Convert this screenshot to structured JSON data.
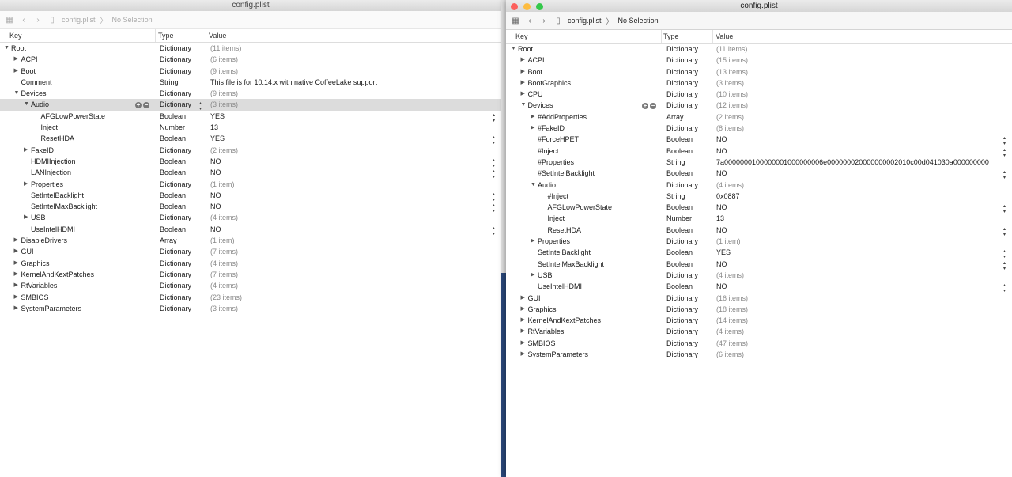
{
  "left": {
    "title": "config.plist",
    "breadcrumb_file": "config.plist",
    "breadcrumb_sep": "〉",
    "breadcrumb_selection": "No Selection",
    "headers": {
      "key": "Key",
      "type": "Type",
      "value": "Value"
    },
    "rows": [
      {
        "k": "Root",
        "t": "Dictionary",
        "v": "(11 items)",
        "lvl": 0,
        "tri": "open",
        "muted": true
      },
      {
        "k": "ACPI",
        "t": "Dictionary",
        "v": "(6 items)",
        "lvl": 1,
        "tri": "closed",
        "muted": true
      },
      {
        "k": "Boot",
        "t": "Dictionary",
        "v": "(9 items)",
        "lvl": 1,
        "tri": "closed",
        "muted": true
      },
      {
        "k": "Comment",
        "t": "String",
        "v": "This file is for 10.14.x with native CoffeeLake support",
        "lvl": 1
      },
      {
        "k": "Devices",
        "t": "Dictionary",
        "v": "(9 items)",
        "lvl": 1,
        "tri": "open",
        "muted": true
      },
      {
        "k": "Audio",
        "t": "Dictionary",
        "v": "(3 items)",
        "lvl": 2,
        "tri": "open",
        "muted": true,
        "sel": true,
        "pm": true,
        "step": true
      },
      {
        "k": "AFGLowPowerState",
        "t": "Boolean",
        "v": "YES",
        "lvl": 3,
        "step": true
      },
      {
        "k": "Inject",
        "t": "Number",
        "v": "13",
        "lvl": 3
      },
      {
        "k": "ResetHDA",
        "t": "Boolean",
        "v": "YES",
        "lvl": 3,
        "step": true
      },
      {
        "k": "FakeID",
        "t": "Dictionary",
        "v": "(2 items)",
        "lvl": 2,
        "tri": "closed",
        "muted": true
      },
      {
        "k": "HDMIInjection",
        "t": "Boolean",
        "v": "NO",
        "lvl": 2,
        "step": true
      },
      {
        "k": "LANInjection",
        "t": "Boolean",
        "v": "NO",
        "lvl": 2,
        "step": true
      },
      {
        "k": "Properties",
        "t": "Dictionary",
        "v": "(1 item)",
        "lvl": 2,
        "tri": "closed",
        "muted": true
      },
      {
        "k": "SetIntelBacklight",
        "t": "Boolean",
        "v": "NO",
        "lvl": 2,
        "step": true
      },
      {
        "k": "SetIntelMaxBacklight",
        "t": "Boolean",
        "v": "NO",
        "lvl": 2,
        "step": true
      },
      {
        "k": "USB",
        "t": "Dictionary",
        "v": "(4 items)",
        "lvl": 2,
        "tri": "closed",
        "muted": true
      },
      {
        "k": "UseIntelHDMI",
        "t": "Boolean",
        "v": "NO",
        "lvl": 2,
        "step": true
      },
      {
        "k": "DisableDrivers",
        "t": "Array",
        "v": "(1 item)",
        "lvl": 1,
        "tri": "closed",
        "muted": true
      },
      {
        "k": "GUI",
        "t": "Dictionary",
        "v": "(7 items)",
        "lvl": 1,
        "tri": "closed",
        "muted": true
      },
      {
        "k": "Graphics",
        "t": "Dictionary",
        "v": "(4 items)",
        "lvl": 1,
        "tri": "closed",
        "muted": true
      },
      {
        "k": "KernelAndKextPatches",
        "t": "Dictionary",
        "v": "(7 items)",
        "lvl": 1,
        "tri": "closed",
        "muted": true
      },
      {
        "k": "RtVariables",
        "t": "Dictionary",
        "v": "(4 items)",
        "lvl": 1,
        "tri": "closed",
        "muted": true
      },
      {
        "k": "SMBIOS",
        "t": "Dictionary",
        "v": "(23 items)",
        "lvl": 1,
        "tri": "closed",
        "muted": true
      },
      {
        "k": "SystemParameters",
        "t": "Dictionary",
        "v": "(3 items)",
        "lvl": 1,
        "tri": "closed",
        "muted": true
      }
    ]
  },
  "right": {
    "title": "config.plist",
    "breadcrumb_file": "config.plist",
    "breadcrumb_sep": "〉",
    "breadcrumb_selection": "No Selection",
    "headers": {
      "key": "Key",
      "type": "Type",
      "value": "Value"
    },
    "rows": [
      {
        "k": "Root",
        "t": "Dictionary",
        "v": "(11 items)",
        "lvl": 0,
        "tri": "open",
        "muted": true
      },
      {
        "k": "ACPI",
        "t": "Dictionary",
        "v": "(15 items)",
        "lvl": 1,
        "tri": "closed",
        "muted": true
      },
      {
        "k": "Boot",
        "t": "Dictionary",
        "v": "(13 items)",
        "lvl": 1,
        "tri": "closed",
        "muted": true
      },
      {
        "k": "BootGraphics",
        "t": "Dictionary",
        "v": "(3 items)",
        "lvl": 1,
        "tri": "closed",
        "muted": true
      },
      {
        "k": "CPU",
        "t": "Dictionary",
        "v": "(10 items)",
        "lvl": 1,
        "tri": "closed",
        "muted": true
      },
      {
        "k": "Devices",
        "t": "Dictionary",
        "v": "(12 items)",
        "lvl": 1,
        "tri": "open",
        "muted": true,
        "pm": true
      },
      {
        "k": "#AddProperties",
        "t": "Array",
        "v": "(2 items)",
        "lvl": 2,
        "tri": "closed",
        "muted": true
      },
      {
        "k": "#FakeID",
        "t": "Dictionary",
        "v": "(8 items)",
        "lvl": 2,
        "tri": "closed",
        "muted": true
      },
      {
        "k": "#ForceHPET",
        "t": "Boolean",
        "v": "NO",
        "lvl": 2,
        "step": true
      },
      {
        "k": "#Inject",
        "t": "Boolean",
        "v": "NO",
        "lvl": 2,
        "step": true
      },
      {
        "k": "#Properties",
        "t": "String",
        "v": "7a0000000100000001000000006e000000020000000002010c00d041030a000000000",
        "lvl": 2
      },
      {
        "k": "#SetIntelBacklight",
        "t": "Boolean",
        "v": "NO",
        "lvl": 2,
        "step": true
      },
      {
        "k": "Audio",
        "t": "Dictionary",
        "v": "(4 items)",
        "lvl": 2,
        "tri": "open",
        "muted": true
      },
      {
        "k": "#Inject",
        "t": "String",
        "v": "0x0887",
        "lvl": 3
      },
      {
        "k": "AFGLowPowerState",
        "t": "Boolean",
        "v": "NO",
        "lvl": 3,
        "step": true
      },
      {
        "k": "Inject",
        "t": "Number",
        "v": "13",
        "lvl": 3
      },
      {
        "k": "ResetHDA",
        "t": "Boolean",
        "v": "NO",
        "lvl": 3,
        "step": true
      },
      {
        "k": "Properties",
        "t": "Dictionary",
        "v": "(1 item)",
        "lvl": 2,
        "tri": "closed",
        "muted": true
      },
      {
        "k": "SetIntelBacklight",
        "t": "Boolean",
        "v": "YES",
        "lvl": 2,
        "step": true
      },
      {
        "k": "SetIntelMaxBacklight",
        "t": "Boolean",
        "v": "NO",
        "lvl": 2,
        "step": true
      },
      {
        "k": "USB",
        "t": "Dictionary",
        "v": "(4 items)",
        "lvl": 2,
        "tri": "closed",
        "muted": true
      },
      {
        "k": "UseIntelHDMI",
        "t": "Boolean",
        "v": "NO",
        "lvl": 2,
        "step": true
      },
      {
        "k": "GUI",
        "t": "Dictionary",
        "v": "(16 items)",
        "lvl": 1,
        "tri": "closed",
        "muted": true
      },
      {
        "k": "Graphics",
        "t": "Dictionary",
        "v": "(18 items)",
        "lvl": 1,
        "tri": "closed",
        "muted": true
      },
      {
        "k": "KernelAndKextPatches",
        "t": "Dictionary",
        "v": "(14 items)",
        "lvl": 1,
        "tri": "closed",
        "muted": true
      },
      {
        "k": "RtVariables",
        "t": "Dictionary",
        "v": "(4 items)",
        "lvl": 1,
        "tri": "closed",
        "muted": true
      },
      {
        "k": "SMBIOS",
        "t": "Dictionary",
        "v": "(47 items)",
        "lvl": 1,
        "tri": "closed",
        "muted": true
      },
      {
        "k": "SystemParameters",
        "t": "Dictionary",
        "v": "(6 items)",
        "lvl": 1,
        "tri": "closed",
        "muted": true
      }
    ]
  },
  "colors": {
    "selection": "#dcdcdc",
    "close": "#fc605c",
    "minimize": "#fdbc40",
    "zoom": "#34c84a",
    "desktop": "#2b4a7e"
  }
}
